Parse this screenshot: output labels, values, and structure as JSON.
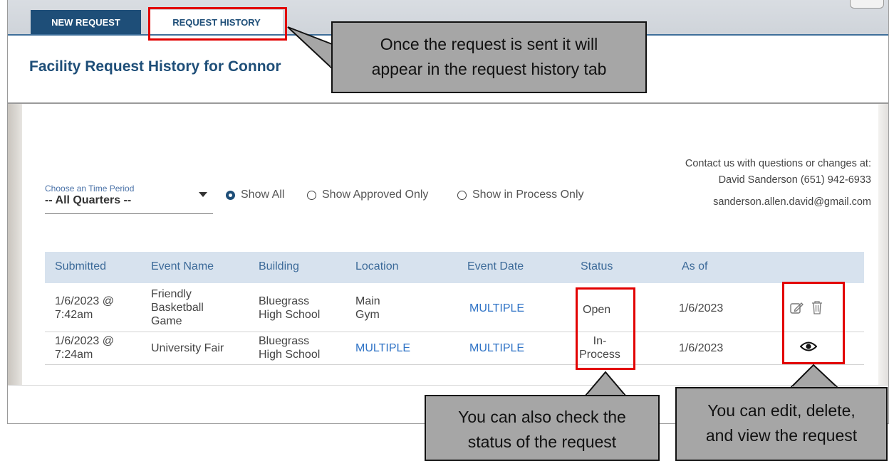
{
  "tabs": {
    "new_request": "NEW REQUEST",
    "request_history": "REQUEST HISTORY"
  },
  "page": {
    "title": "Facility Request History for Connor"
  },
  "filters": {
    "period_label": "Choose an Time Period",
    "period_value": "-- All Quarters --",
    "radio_show_all": "Show All",
    "radio_approved": "Show Approved Only",
    "radio_in_process": "Show in Process Only",
    "selected": "Show All"
  },
  "contact": {
    "heading": "Contact us with questions or changes at:",
    "person": "David Sanderson (651) 942-6933",
    "email": "sanderson.allen.david@gmail.com"
  },
  "table": {
    "columns": [
      "Submitted",
      "Event Name",
      "Building",
      "Location",
      "Event Date",
      "Status",
      "As of"
    ],
    "rows": [
      {
        "submitted_1": "1/6/2023 @",
        "submitted_2": "7:42am",
        "event_1": "Friendly",
        "event_2": "Basketball",
        "event_3": "Game",
        "building_1": "Bluegrass",
        "building_2": "High School",
        "location_1": "Main",
        "location_2": "Gym",
        "event_date": "MULTIPLE",
        "status": "Open",
        "as_of": "1/6/2023",
        "actions": [
          "edit-icon",
          "trash-icon"
        ]
      },
      {
        "submitted_1": "1/6/2023 @",
        "submitted_2": "7:24am",
        "event_1": "University Fair",
        "building_1": "Bluegrass",
        "building_2": "High School",
        "location_1": "MULTIPLE",
        "event_date": "MULTIPLE",
        "status_1": "In-",
        "status_2": "Process",
        "as_of": "1/6/2023",
        "actions": [
          "eye-icon"
        ]
      }
    ]
  },
  "callouts": {
    "history_1": "Once the request is sent it will",
    "history_2": "appear in the request history tab",
    "status_1": "You can also check the",
    "status_2": "status of the request",
    "actions_1": "You can edit, delete,",
    "actions_2": "and view the request"
  },
  "colors": {
    "accent": "#1e4e78",
    "link": "#2f73c6",
    "highlight": "#e20000",
    "callout_bg": "#a6a6a6",
    "header_bg": "#d7e2ee"
  }
}
